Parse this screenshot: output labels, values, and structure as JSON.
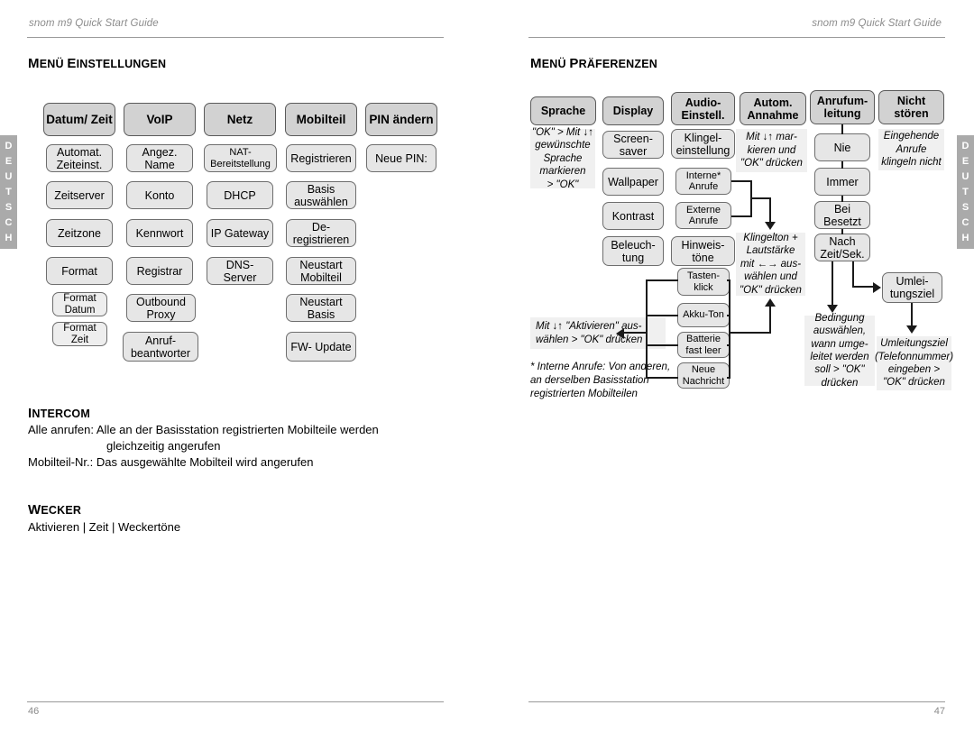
{
  "running_header": "snom m9 Quick Start Guide",
  "side_tab_letters": [
    "D",
    "E",
    "U",
    "T",
    "S",
    "C",
    "H"
  ],
  "left_page": {
    "number": "46",
    "title_big_1": "M",
    "title_rest_1": "ENÜ ",
    "title_big_2": "E",
    "title_rest_2": "INSTELLUNGEN",
    "columns": [
      {
        "header": "Datum/\nZeit",
        "items": [
          "Automat.\nZeiteinst.",
          "Zeitserver",
          "Zeitzone",
          "Format"
        ],
        "subitems": [
          "Format\nDatum",
          "Format\nZeit"
        ]
      },
      {
        "header": "VoIP",
        "items": [
          "Angez.\nName",
          "Konto",
          "Kennwort",
          "Registrar",
          "Outbound\nProxy",
          "Anruf-\nbeantworter"
        ],
        "subitems": []
      },
      {
        "header": "Netz",
        "items": [
          "NAT-\nBereitstellung",
          "DHCP",
          "IP\nGateway",
          "DNS-\nServer"
        ],
        "subitems": []
      },
      {
        "header": "Mobilteil",
        "items": [
          "Registrieren",
          "Basis\nauswählen",
          "De-\nregistrieren",
          "Neustart\nMobilteil",
          "Neustart\nBasis",
          "FW-\nUpdate"
        ],
        "subitems": []
      },
      {
        "header": "PIN\nändern",
        "items": [
          "Neue PIN:"
        ],
        "subitems": []
      }
    ],
    "intercom": {
      "title_big": "I",
      "title_rest": "NTERCOM",
      "line1": "Alle anrufen:  Alle an der Basisstation registrierten Mobilteile werden",
      "line2": "gleichzeitig angerufen",
      "line3": "Mobilteil-Nr.: Das ausgewählte Mobilteil wird angerufen"
    },
    "wecker": {
      "title_big": "W",
      "title_rest": "ECKER",
      "line1": "Aktivieren | Zeit | Weckertöne"
    }
  },
  "right_page": {
    "number": "47",
    "title_big_1": "M",
    "title_rest_1": "ENÜ ",
    "title_big_2": "P",
    "title_rest_2": "RÄFERENZEN",
    "columns": [
      {
        "header": "Sprache",
        "items": []
      },
      {
        "header": "Display",
        "items": [
          "Screen-\nsaver",
          "Wallpaper",
          "Kontrast",
          "Beleuch-\ntung"
        ]
      },
      {
        "header": "Audio-\nEinstell.",
        "items": [
          "Klingel-\neinstellung"
        ]
      },
      {
        "header": "Autom.\nAnnahme",
        "items": []
      },
      {
        "header": "Anrufum-\nleitung",
        "items": [
          "Nie",
          "Immer",
          "Bei\nBesetzt",
          "Nach\nZeit/Sek."
        ]
      },
      {
        "header": "Nicht\nstören",
        "items": []
      }
    ],
    "audio_group_a": [
      "Interne*\nAnrufe",
      "Externe\nAnrufe"
    ],
    "audio_hinweis": "Hinweis-\ntöne",
    "audio_group_b": [
      "Tasten-\nklick",
      "Akku-Ton",
      "Batterie\nfast leer",
      "Neue\nNachricht"
    ],
    "umleitungsziel_box": "Umlei-\ntungsziel",
    "notes": {
      "sprache": "\"OK\" > Mit ↓↑\ngewünschte\nSprache\nmarkieren\n> \"OK\"",
      "autom_annahme": "Mit ↓↑ mar-\nkieren und\n\"OK\" drücken",
      "nicht_stoeren": "Eingehende\nAnrufe\nklingeln nicht",
      "klingelton": "Klingelton +\nLautstärke\nmit ←→ aus-\nwählen und\n\"OK\" drücken",
      "aktivieren": "Mit ↓↑ \"Aktivieren\" aus-\nwählen > \"OK\" drücken",
      "bedingung": "Bedingung\nauswählen,\nwann umge-\nleitet werden\nsoll > \"OK\"\ndrücken",
      "umleitungsziel": "Umleitungsziel\n(Telefonnummer)\neingeben >\n\"OK\" drücken"
    },
    "footnote": "* Interne Anrufe: Von anderen,\n an derselben Basisstation\n registrierten Mobilteilen"
  },
  "colors": {
    "header_box": "#d2d2d2",
    "item_box": "#e6e6e6",
    "sub_box": "#eeeeee",
    "note_bg": "#f0f0f0",
    "tab_gray": "#aaaaaa",
    "rule": "#9a9a9a"
  }
}
